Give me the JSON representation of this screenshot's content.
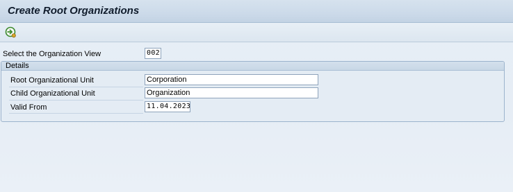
{
  "title_bar": {
    "title": "Create Root Organizations"
  },
  "toolbar": {
    "execute_icon": "execute-icon"
  },
  "form": {
    "org_view": {
      "label": "Select the Organization View",
      "value": "002"
    },
    "details": {
      "title": "Details",
      "fields": [
        {
          "label": "Root Organizational Unit",
          "value": "Corporation"
        },
        {
          "label": "Child Organizational Unit",
          "value": "Organization"
        },
        {
          "label": "Valid From",
          "value": "11.04.2023"
        }
      ]
    }
  },
  "colors": {
    "title_bg": "#cddbea",
    "panel_bg": "#e4ecf4",
    "execute_icon_green": "#3c8a2e"
  }
}
